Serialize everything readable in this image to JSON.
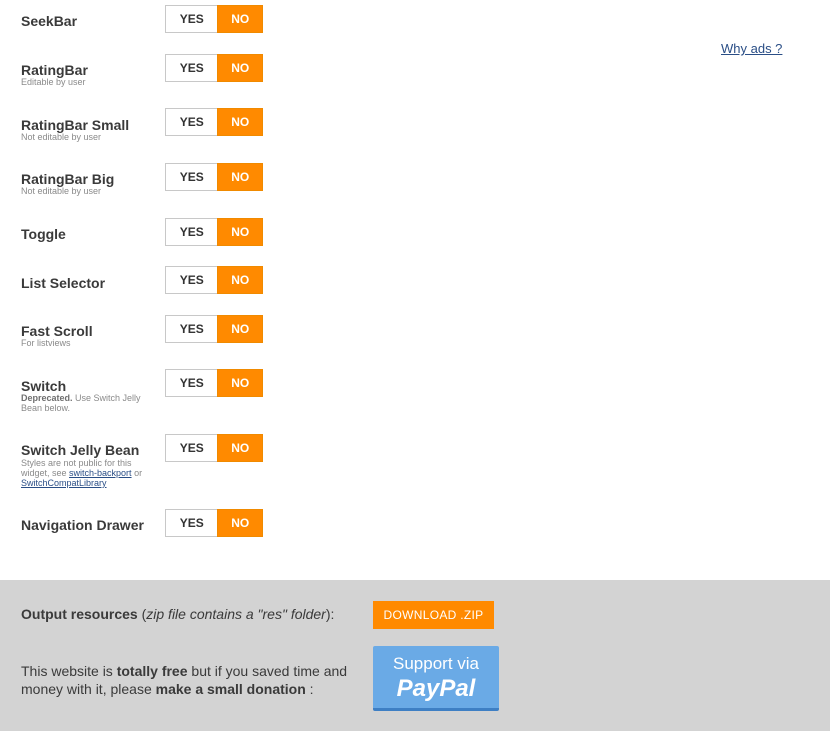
{
  "header": {
    "why_ads": "Why ads ?"
  },
  "rows": [
    {
      "title": "SeekBar",
      "yes": "YES",
      "no": "NO"
    },
    {
      "title": "RatingBar",
      "subtitle": "Editable by user",
      "yes": "YES",
      "no": "NO"
    },
    {
      "title": "RatingBar Small",
      "subtitle": "Not editable by user",
      "yes": "YES",
      "no": "NO"
    },
    {
      "title": "RatingBar Big",
      "subtitle": "Not editable by user",
      "yes": "YES",
      "no": "NO"
    },
    {
      "title": "Toggle",
      "yes": "YES",
      "no": "NO"
    },
    {
      "title": "List Selector",
      "yes": "YES",
      "no": "NO"
    },
    {
      "title": "Fast Scroll",
      "subtitle": "For listviews",
      "yes": "YES",
      "no": "NO"
    },
    {
      "title": "Switch",
      "subtitle_bold": "Deprecated.",
      "subtitle_rest": " Use Switch Jelly Bean below.",
      "yes": "YES",
      "no": "NO"
    },
    {
      "title": "Switch Jelly Bean",
      "subtitle_pre": "Styles are not public for this widget, see ",
      "link1": "switch-backport",
      "subtitle_mid": " or ",
      "link2": "SwitchCompatLibrary",
      "yes": "YES",
      "no": "NO"
    },
    {
      "title": "Navigation Drawer",
      "yes": "YES",
      "no": "NO"
    }
  ],
  "footer": {
    "output_bold": "Output resources",
    "output_paren_open": " (",
    "output_italic": "zip file contains a \"res\" folder",
    "output_paren_close": "):",
    "download_label": "DOWNLOAD .ZIP",
    "donation_pre": "This website is ",
    "donation_bold1": "totally free",
    "donation_mid": " but if you saved time and money with it, please ",
    "donation_bold2": "make a small donation",
    "donation_post": " :",
    "paypal_line1": "Support via",
    "paypal_line2": "PayPal"
  },
  "colors": {
    "accent": "#ff8a00",
    "footer_bg": "#d3d3d3",
    "link": "#2a4e86",
    "paypal": "#6aaae6"
  }
}
